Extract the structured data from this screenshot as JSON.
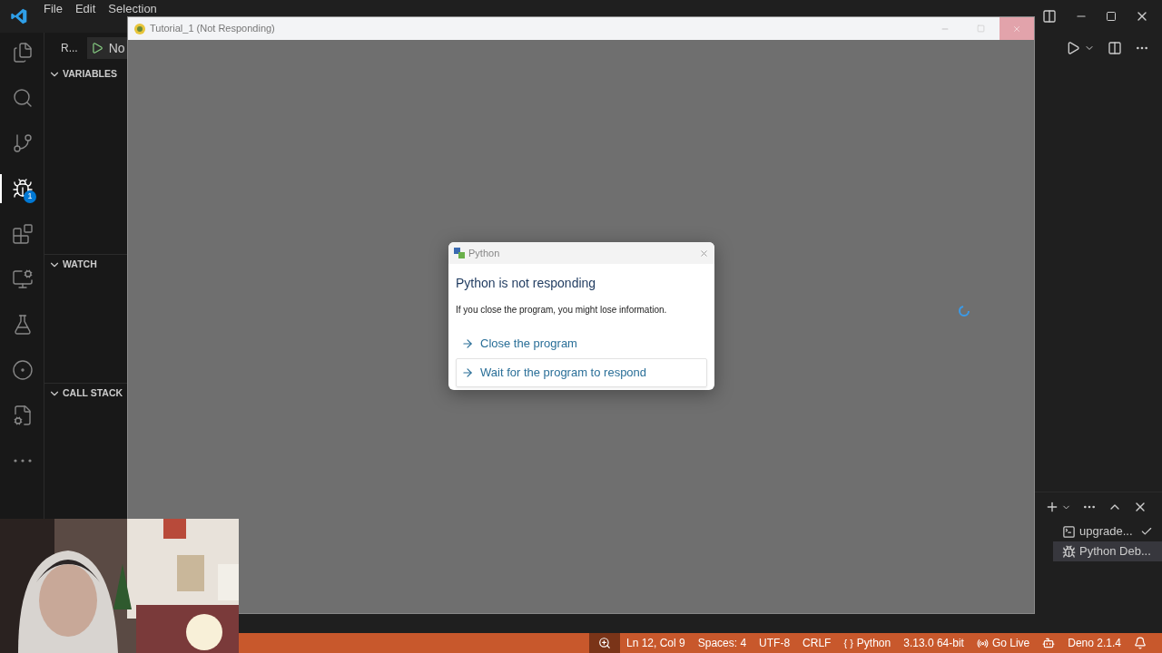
{
  "menu": [
    "File",
    "Edit",
    "Selection"
  ],
  "activity_bar": {
    "badge": "1",
    "items": [
      {
        "kind": "explorer",
        "selected": false
      },
      {
        "kind": "search",
        "selected": false
      },
      {
        "kind": "source-control",
        "selected": false
      },
      {
        "kind": "run-debug",
        "selected": true
      },
      {
        "kind": "extensions",
        "selected": false
      },
      {
        "kind": "remote",
        "selected": false
      },
      {
        "kind": "testing",
        "selected": false
      },
      {
        "kind": "browser",
        "selected": false
      },
      {
        "kind": "file-settings",
        "selected": false
      },
      {
        "kind": "more",
        "selected": false
      }
    ]
  },
  "sidebar": {
    "header": "R...",
    "run_config": "No",
    "sections": [
      {
        "title": "VARIABLES",
        "expanded": true
      },
      {
        "title": "WATCH",
        "expanded": true
      },
      {
        "title": "CALL STACK",
        "expanded": true
      }
    ]
  },
  "app_window": {
    "title": "Tutorial_1 (Not Responding)"
  },
  "dialog": {
    "title": "Python",
    "heading": "Python is not responding",
    "message": "If you close the program, you might lose information.",
    "options": [
      {
        "label": "Close the program",
        "selected": false
      },
      {
        "label": "Wait for the program to respond",
        "selected": true
      }
    ]
  },
  "terminal_tabs": [
    {
      "label": "upgrade...",
      "kind": "shell",
      "selected": false,
      "succeeded": true
    },
    {
      "label": "Python Deb...",
      "kind": "debug",
      "selected": true,
      "succeeded": false
    }
  ],
  "status_bar": [
    {
      "kind": "zoom"
    },
    {
      "kind": "text",
      "text": "Ln 12, Col 9"
    },
    {
      "kind": "text",
      "text": "Spaces: 4"
    },
    {
      "kind": "text",
      "text": "UTF-8"
    },
    {
      "kind": "text",
      "text": "CRLF"
    },
    {
      "kind": "braces",
      "icon_text": "{ }",
      "text": "Python"
    },
    {
      "kind": "text",
      "text": "3.13.0 64-bit"
    },
    {
      "kind": "live",
      "text": "Go Live"
    },
    {
      "kind": "copilot"
    },
    {
      "kind": "text",
      "text": "Deno 2.1.4"
    },
    {
      "kind": "bell"
    }
  ]
}
